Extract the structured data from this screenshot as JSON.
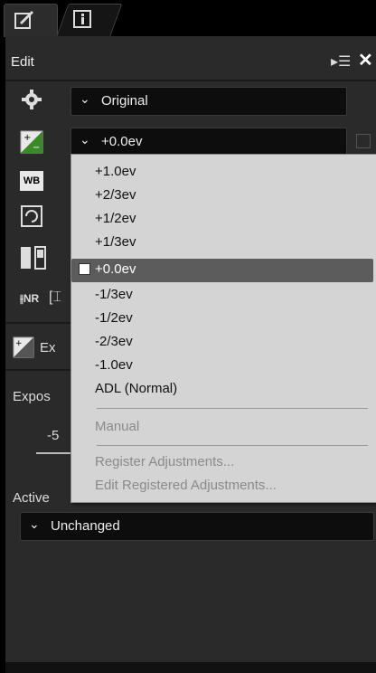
{
  "tabs": [
    {
      "name": "edit",
      "icon": "pencil-square-icon"
    },
    {
      "name": "info",
      "icon": "info-icon"
    }
  ],
  "header": {
    "title": "Edit"
  },
  "controls": {
    "picture_control": "Original",
    "exposure_value": "+0.0ev"
  },
  "section": {
    "title_fragment": "Ex",
    "exposure_label": "Expos",
    "slider_min": "-5",
    "active_label": "Active",
    "active_value": "Unchanged"
  },
  "menu": {
    "items": [
      "+1.0ev",
      "+2/3ev",
      "+1/2ev",
      "+1/3ev",
      "+0.0ev",
      "-1/3ev",
      "-1/2ev",
      "-2/3ev",
      "-1.0ev",
      "ADL (Normal)"
    ],
    "selected": "+0.0ev",
    "manual": "Manual",
    "register": "Register Adjustments...",
    "edit_registered": "Edit Registered Adjustments..."
  }
}
